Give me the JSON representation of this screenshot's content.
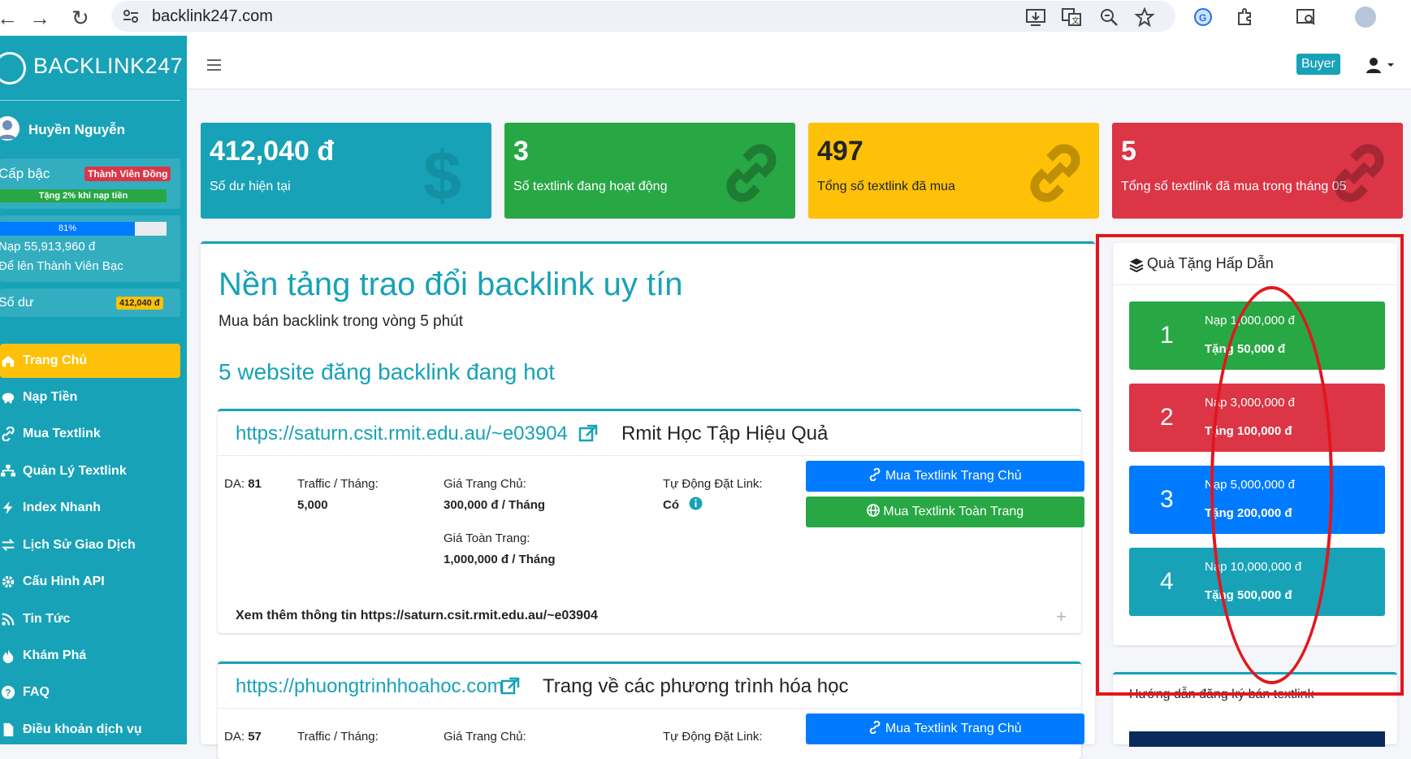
{
  "browser": {
    "url": "backlink247.com"
  },
  "brand": {
    "name": "BACKLINK247"
  },
  "user": {
    "name": "Huyền Nguyễn",
    "rank_label": "Cấp bậc",
    "rank_badge": "Thành Viên Đồng",
    "rank_bonus": "Tặng 2% khi nạp tiền",
    "progress_label": "81%",
    "progress_value": 81,
    "topup_amount": "Nạp 55,913,960 đ",
    "topup_next": "Để lên Thành Viên Bạc",
    "balance_label": "Số dư",
    "balance_value": "412,040 đ"
  },
  "menu": [
    {
      "label": "Trang Chủ",
      "icon": "home-icon"
    },
    {
      "label": "Nạp Tiền",
      "icon": "piggy-bank-icon"
    },
    {
      "label": "Mua Textlink",
      "icon": "link-icon"
    },
    {
      "label": "Quản Lý Textlink",
      "icon": "sitemap-icon"
    },
    {
      "label": "Index Nhanh",
      "icon": "bolt-icon"
    },
    {
      "label": "Lịch Sử Giao Dịch",
      "icon": "exchange-icon"
    },
    {
      "label": "Cấu Hình API",
      "icon": "cog-icon"
    },
    {
      "label": "Tin Tức",
      "icon": "rss-icon"
    },
    {
      "label": "Khám Phá",
      "icon": "fire-icon"
    },
    {
      "label": "FAQ",
      "icon": "question-icon"
    },
    {
      "label": "Điều khoản dịch vụ",
      "icon": "file-icon"
    }
  ],
  "navbar": {
    "buyer_label": "Buyer"
  },
  "stats": [
    {
      "value": "412,040 đ",
      "label": "Số dư hiện tại",
      "color": "#17a2b8",
      "icon": "dollar-icon"
    },
    {
      "value": "3",
      "label": "Số textlink đang hoạt động",
      "color": "#28a745",
      "icon": "link-icon"
    },
    {
      "value": "497",
      "label": "Tổng số textlink đã mua",
      "color": "#ffc107",
      "icon": "link-icon"
    },
    {
      "value": "5",
      "label": "Tổng số textlink đã mua trong tháng 05",
      "color": "#dc3545",
      "icon": "link-icon"
    }
  ],
  "hero": {
    "title": "Nền tảng trao đổi backlink uy tín",
    "subtitle": "Mua bán backlink trong vòng 5 phút",
    "hot_title": "5 website đăng backlink đang hot"
  },
  "sites": [
    {
      "url": "https://saturn.csit.rmit.edu.au/~e03904",
      "desc": "Rmit Học Tập Hiệu Quả",
      "da_label": "DA:",
      "da": "81",
      "traffic_label": "Traffic / Tháng:",
      "traffic": "5,000",
      "home_price_label": "Giá Trang Chủ:",
      "home_price": "300,000 đ / Tháng",
      "all_price_label": "Giá Toàn Trang:",
      "all_price": "1,000,000 đ / Tháng",
      "auto_label": "Tự Động Đặt Link:",
      "auto": "Có",
      "btn_home": "Mua Textlink Trang Chủ",
      "btn_all": "Mua Textlink Toàn Trang",
      "more": "Xem thêm thông tin https://saturn.csit.rmit.edu.au/~e03904"
    },
    {
      "url": "https://phuongtrinhhoahoc.com",
      "desc": "Trang về các phương trình hóa học",
      "da_label": "DA:",
      "da": "57",
      "traffic_label": "Traffic / Tháng:",
      "home_price_label": "Giá Trang Chủ:",
      "auto_label": "Tự Động Đặt Link:",
      "btn_home": "Mua Textlink Trang Chủ"
    }
  ],
  "gifts": {
    "title": "Quà Tặng Hấp Dẫn",
    "items": [
      {
        "num": "1",
        "topup": "Nạp 1,000,000 đ",
        "bonus": "Tặng 50,000 đ",
        "color": "#28a745"
      },
      {
        "num": "2",
        "topup": "Nạp 3,000,000 đ",
        "bonus": "Tặng 100,000 đ",
        "color": "#dc3545"
      },
      {
        "num": "3",
        "topup": "Nạp 5,000,000 đ",
        "bonus": "Tặng 200,000 đ",
        "color": "#007bff"
      },
      {
        "num": "4",
        "topup": "Nạp 10,000,000 đ",
        "bonus": "Tặng 500,000 đ",
        "color": "#17a2b8"
      }
    ]
  },
  "guide": {
    "title": "Hướng dẫn đăng ký bán textlink"
  }
}
